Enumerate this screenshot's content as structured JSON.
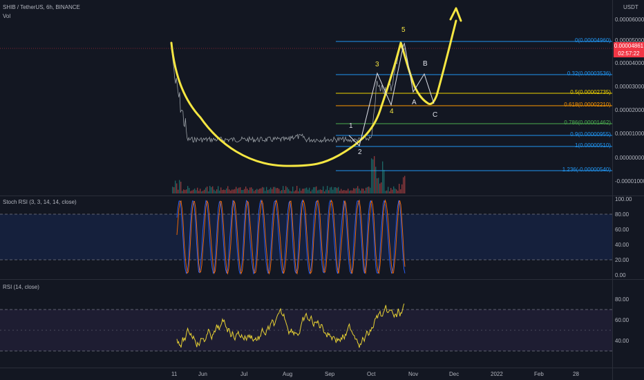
{
  "header": {
    "symbol": "SHIB / TetherUS, 6h, BINANCE",
    "vol": "Vol",
    "currency": "USDT"
  },
  "price_axis": {
    "labels": [
      "0.00006000",
      "0.00005000",
      "0.00004000",
      "0.00003000",
      "0.00002000",
      "0.00001000",
      "0.00000000",
      "-0.00001000"
    ]
  },
  "price_tag": {
    "price": "0.00004861",
    "countdown": "02:57:22"
  },
  "fib_levels": [
    {
      "label": "0(0.00004960)",
      "color": "#2196f3"
    },
    {
      "label": "0.32(0.00003536)",
      "color": "#2196f3"
    },
    {
      "label": "0.5(0.00002735)",
      "color": "#f2d600"
    },
    {
      "label": "0.618(0.00002210)",
      "color": "#ff9800"
    },
    {
      "label": "0.786(0.00001462)",
      "color": "#4caf50"
    },
    {
      "label": "0.9(0.00000955)",
      "color": "#2196f3"
    },
    {
      "label": "1(0.00000510)",
      "color": "#2196f3"
    },
    {
      "label": "1.236(-0.00000540)",
      "color": "#2196f3"
    }
  ],
  "wave_labels": [
    "1",
    "2",
    "3",
    "4",
    "5",
    "A",
    "B",
    "C"
  ],
  "stoch": {
    "title": "Stoch RSI (3, 3, 14, 14, close)",
    "axis": [
      "100.00",
      "80.00",
      "60.00",
      "40.00",
      "20.00",
      "0.00"
    ]
  },
  "rsi": {
    "title": "RSI (14, close)",
    "axis": [
      "80.00",
      "60.00",
      "40.00"
    ]
  },
  "time_axis": [
    "11",
    "Jun",
    "Jul",
    "Aug",
    "Sep",
    "Oct",
    "Nov",
    "Dec",
    "2022",
    "Feb",
    "28"
  ]
}
